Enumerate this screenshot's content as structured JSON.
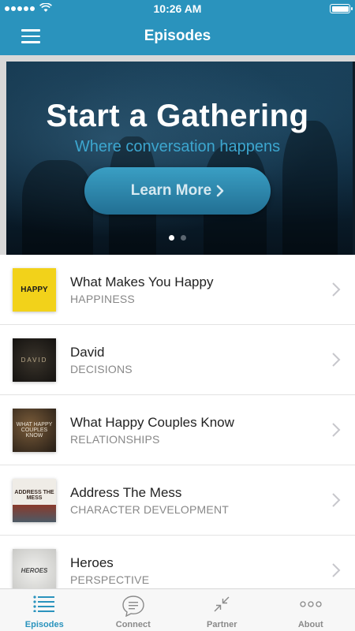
{
  "status_bar": {
    "time": "10:26 AM"
  },
  "nav": {
    "title": "Episodes",
    "menu_icon": "hamburger-icon"
  },
  "banner": {
    "title": "Start a Gathering",
    "subtitle": "Where conversation happens",
    "button_label": "Learn More",
    "page_count": 2,
    "active_page": 0
  },
  "episodes": [
    {
      "title": "What Makes You Happy",
      "category": "HAPPINESS",
      "thumb_text": "HAPPY",
      "thumb_bg": "#f2d21a",
      "thumb_fg": "#1a1a1a"
    },
    {
      "title": "David",
      "category": "DECISIONS",
      "thumb_text": "DAVID",
      "thumb_bg": "#1e1b17",
      "thumb_fg": "#b9a98a"
    },
    {
      "title": "What Happy Couples Know",
      "category": "RELATIONSHIPS",
      "thumb_text": "WHAT HAPPY COUPLES KNOW",
      "thumb_bg": "#3b3128",
      "thumb_fg": "#e9e2d6"
    },
    {
      "title": "Address The Mess",
      "category": "CHARACTER DEVELOPMENT",
      "thumb_text": "ADDRESS THE MESS",
      "thumb_bg": "#e9e6df",
      "thumb_fg": "#3a2b24"
    },
    {
      "title": "Heroes",
      "category": "PERSPECTIVE",
      "thumb_text": "HEROES",
      "thumb_bg": "#d9d9d7",
      "thumb_fg": "#4a4a4a"
    }
  ],
  "tabs": [
    {
      "label": "Episodes",
      "icon": "list-icon",
      "active": true
    },
    {
      "label": "Connect",
      "icon": "chat-bubble-icon",
      "active": false
    },
    {
      "label": "Partner",
      "icon": "arrows-in-icon",
      "active": false
    },
    {
      "label": "About",
      "icon": "more-dots-icon",
      "active": false
    }
  ],
  "colors": {
    "accent": "#2a93bd",
    "banner_subtitle": "#3ca6cf",
    "chevron": "#c7c7cc"
  }
}
